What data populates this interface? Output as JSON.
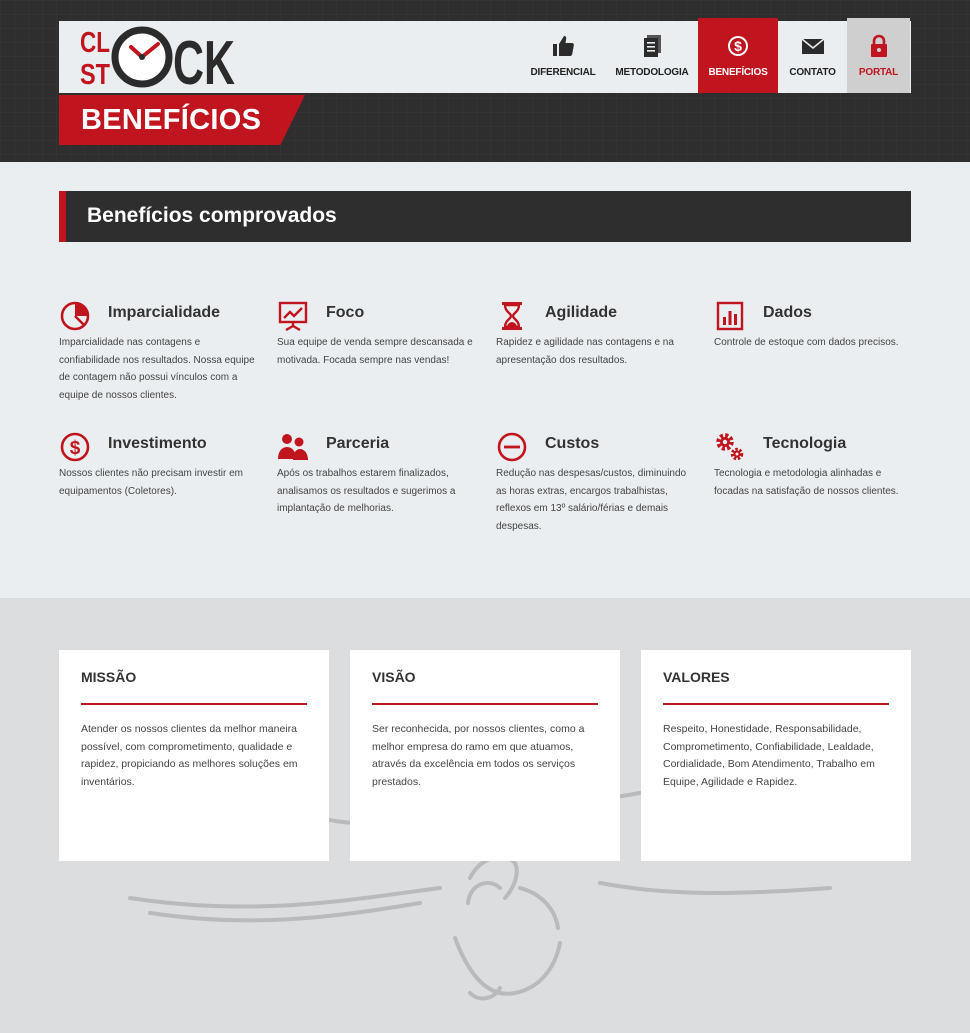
{
  "brand": {
    "name": "CL ST CK",
    "logo_text_top": "CL",
    "logo_text_bottom": "ST",
    "logo_text_right": "CK",
    "colors": {
      "accent": "#c0141e",
      "dark": "#2f2e2f",
      "light": "#ebeef0"
    }
  },
  "nav": {
    "items": [
      {
        "label": "DIFERENCIAL",
        "icon": "thumbs-up-icon"
      },
      {
        "label": "METODOLOGIA",
        "icon": "document-icon"
      },
      {
        "label": "BENEFÍCIOS",
        "icon": "dollar-circle-icon",
        "active": true
      },
      {
        "label": "CONTATO",
        "icon": "envelope-icon"
      },
      {
        "label": "PORTAL",
        "icon": "lock-icon"
      }
    ]
  },
  "page": {
    "title": "BENEFÍCIOS"
  },
  "benefits": {
    "heading": "Benefícios comprovados",
    "items": [
      {
        "title": "Imparcialidade",
        "icon": "pie-chart-icon",
        "text": "Imparcialidade nas contagens e confiabilidade nos resultados. Nossa equipe de contagem não possui vínculos com a equipe de nossos clientes."
      },
      {
        "title": "Foco",
        "icon": "presentation-icon",
        "text": "Sua equipe de venda sempre descansada e motivada. Focada sempre nas vendas!"
      },
      {
        "title": "Agilidade",
        "icon": "hourglass-icon",
        "text": "Rapidez e agilidade nas contagens e na apresentação dos resultados."
      },
      {
        "title": "Dados",
        "icon": "bar-chart-icon",
        "text": "Controle de estoque com dados precisos."
      },
      {
        "title": "Investimento",
        "icon": "dollar-circle-icon",
        "text": "Nossos clientes não precisam investir em equipamentos (Coletores)."
      },
      {
        "title": "Parceria",
        "icon": "users-icon",
        "text": "Após os trabalhos estarem finalizados, analisamos os resultados e sugerimos a implantação de melhorias."
      },
      {
        "title": "Custos",
        "icon": "minus-circle-icon",
        "text": "Redução nas despesas/custos, diminuindo as horas extras, encargos trabalhistas, reflexos em 13º salário/férias e demais despesas."
      },
      {
        "title": "Tecnologia",
        "icon": "gears-icon",
        "text": "Tecnologia e metodologia alinhadas e focadas na satisfação de nossos clientes."
      }
    ]
  },
  "cards": [
    {
      "title": "MISSÃO",
      "text": "Atender os nossos clientes da melhor maneira possível, com comprometimento, qualidade e rapidez, propiciando as melhores soluções em inventários."
    },
    {
      "title": "VISÃO",
      "text": "Ser reconhecida, por nossos clientes, como a melhor empresa do ramo em que atuamos, através da excelência em todos os serviços prestados."
    },
    {
      "title": "VALORES",
      "text": "Respeito, Honestidade, Responsabilidade, Comprometimento, Confiabilidade, Lealdade, Cordialidade, Bom Atendimento, Trabalho em Equipe, Agilidade e Rapidez."
    }
  ]
}
